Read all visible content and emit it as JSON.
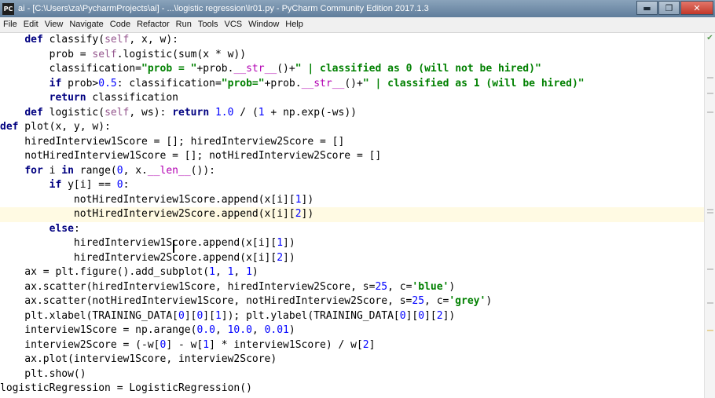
{
  "window": {
    "icon": "PC",
    "title": "ai - [C:\\Users\\za\\PycharmProjects\\ai] - ...\\logistic regression\\lr01.py - PyCharm Community Edition 2017.1.3",
    "minimize": "▬",
    "maximize": "❐",
    "close": "✕"
  },
  "menu": [
    "File",
    "Edit",
    "View",
    "Navigate",
    "Code",
    "Refactor",
    "Run",
    "Tools",
    "VCS",
    "Window",
    "Help"
  ],
  "editor": {
    "lines": [
      "    def classify(self, x, w):",
      "        prob = self.logistic(sum(x * w))",
      "        classification=\"prob = \"+prob.__str__()+\" | classified as 0 (will not be hired)\"",
      "        if prob>0.5: classification=\"prob=\"+prob.__str__()+\" | classified as 1 (will be hired)\"",
      "        return classification",
      "    def logistic(self, ws): return 1.0 / (1 + np.exp(-ws))",
      "def plot(x, y, w):",
      "    hiredInterview1Score = []; hiredInterview2Score = []",
      "    notHiredInterview1Score = []; notHiredInterview2Score = []",
      "    for i in range(0, x.__len__()):",
      "        if y[i] == 0:",
      "            notHiredInterview1Score.append(x[i][1])",
      "            notHiredInterview2Score.append(x[i][2])",
      "        else:",
      "            hiredInterview1Score.append(x[i][1])",
      "            hiredInterview2Score.append(x[i][2])",
      "    ax = plt.figure().add_subplot(1, 1, 1)",
      "    ax.scatter(hiredInterview1Score, hiredInterview2Score, s=25, c='blue')",
      "    ax.scatter(notHiredInterview1Score, notHiredInterview2Score, s=25, c='grey')",
      "    plt.xlabel(TRAINING_DATA[0][0][1]); plt.ylabel(TRAINING_DATA[0][0][2])",
      "    interview1Score = np.arange(0.0, 10.0, 0.01)",
      "    interview2Score = (-w[0] - w[1] * interview1Score) / w[2]",
      "    ax.plot(interview1Score, interview2Score)",
      "    plt.show()",
      "logisticRegression = LogisticRegression()"
    ],
    "current_line": 12,
    "colors": {
      "keyword": "#000080",
      "string": "#008000",
      "number": "#0000ff",
      "self": "#94558d",
      "current_line_bg": "#fffae3"
    }
  }
}
